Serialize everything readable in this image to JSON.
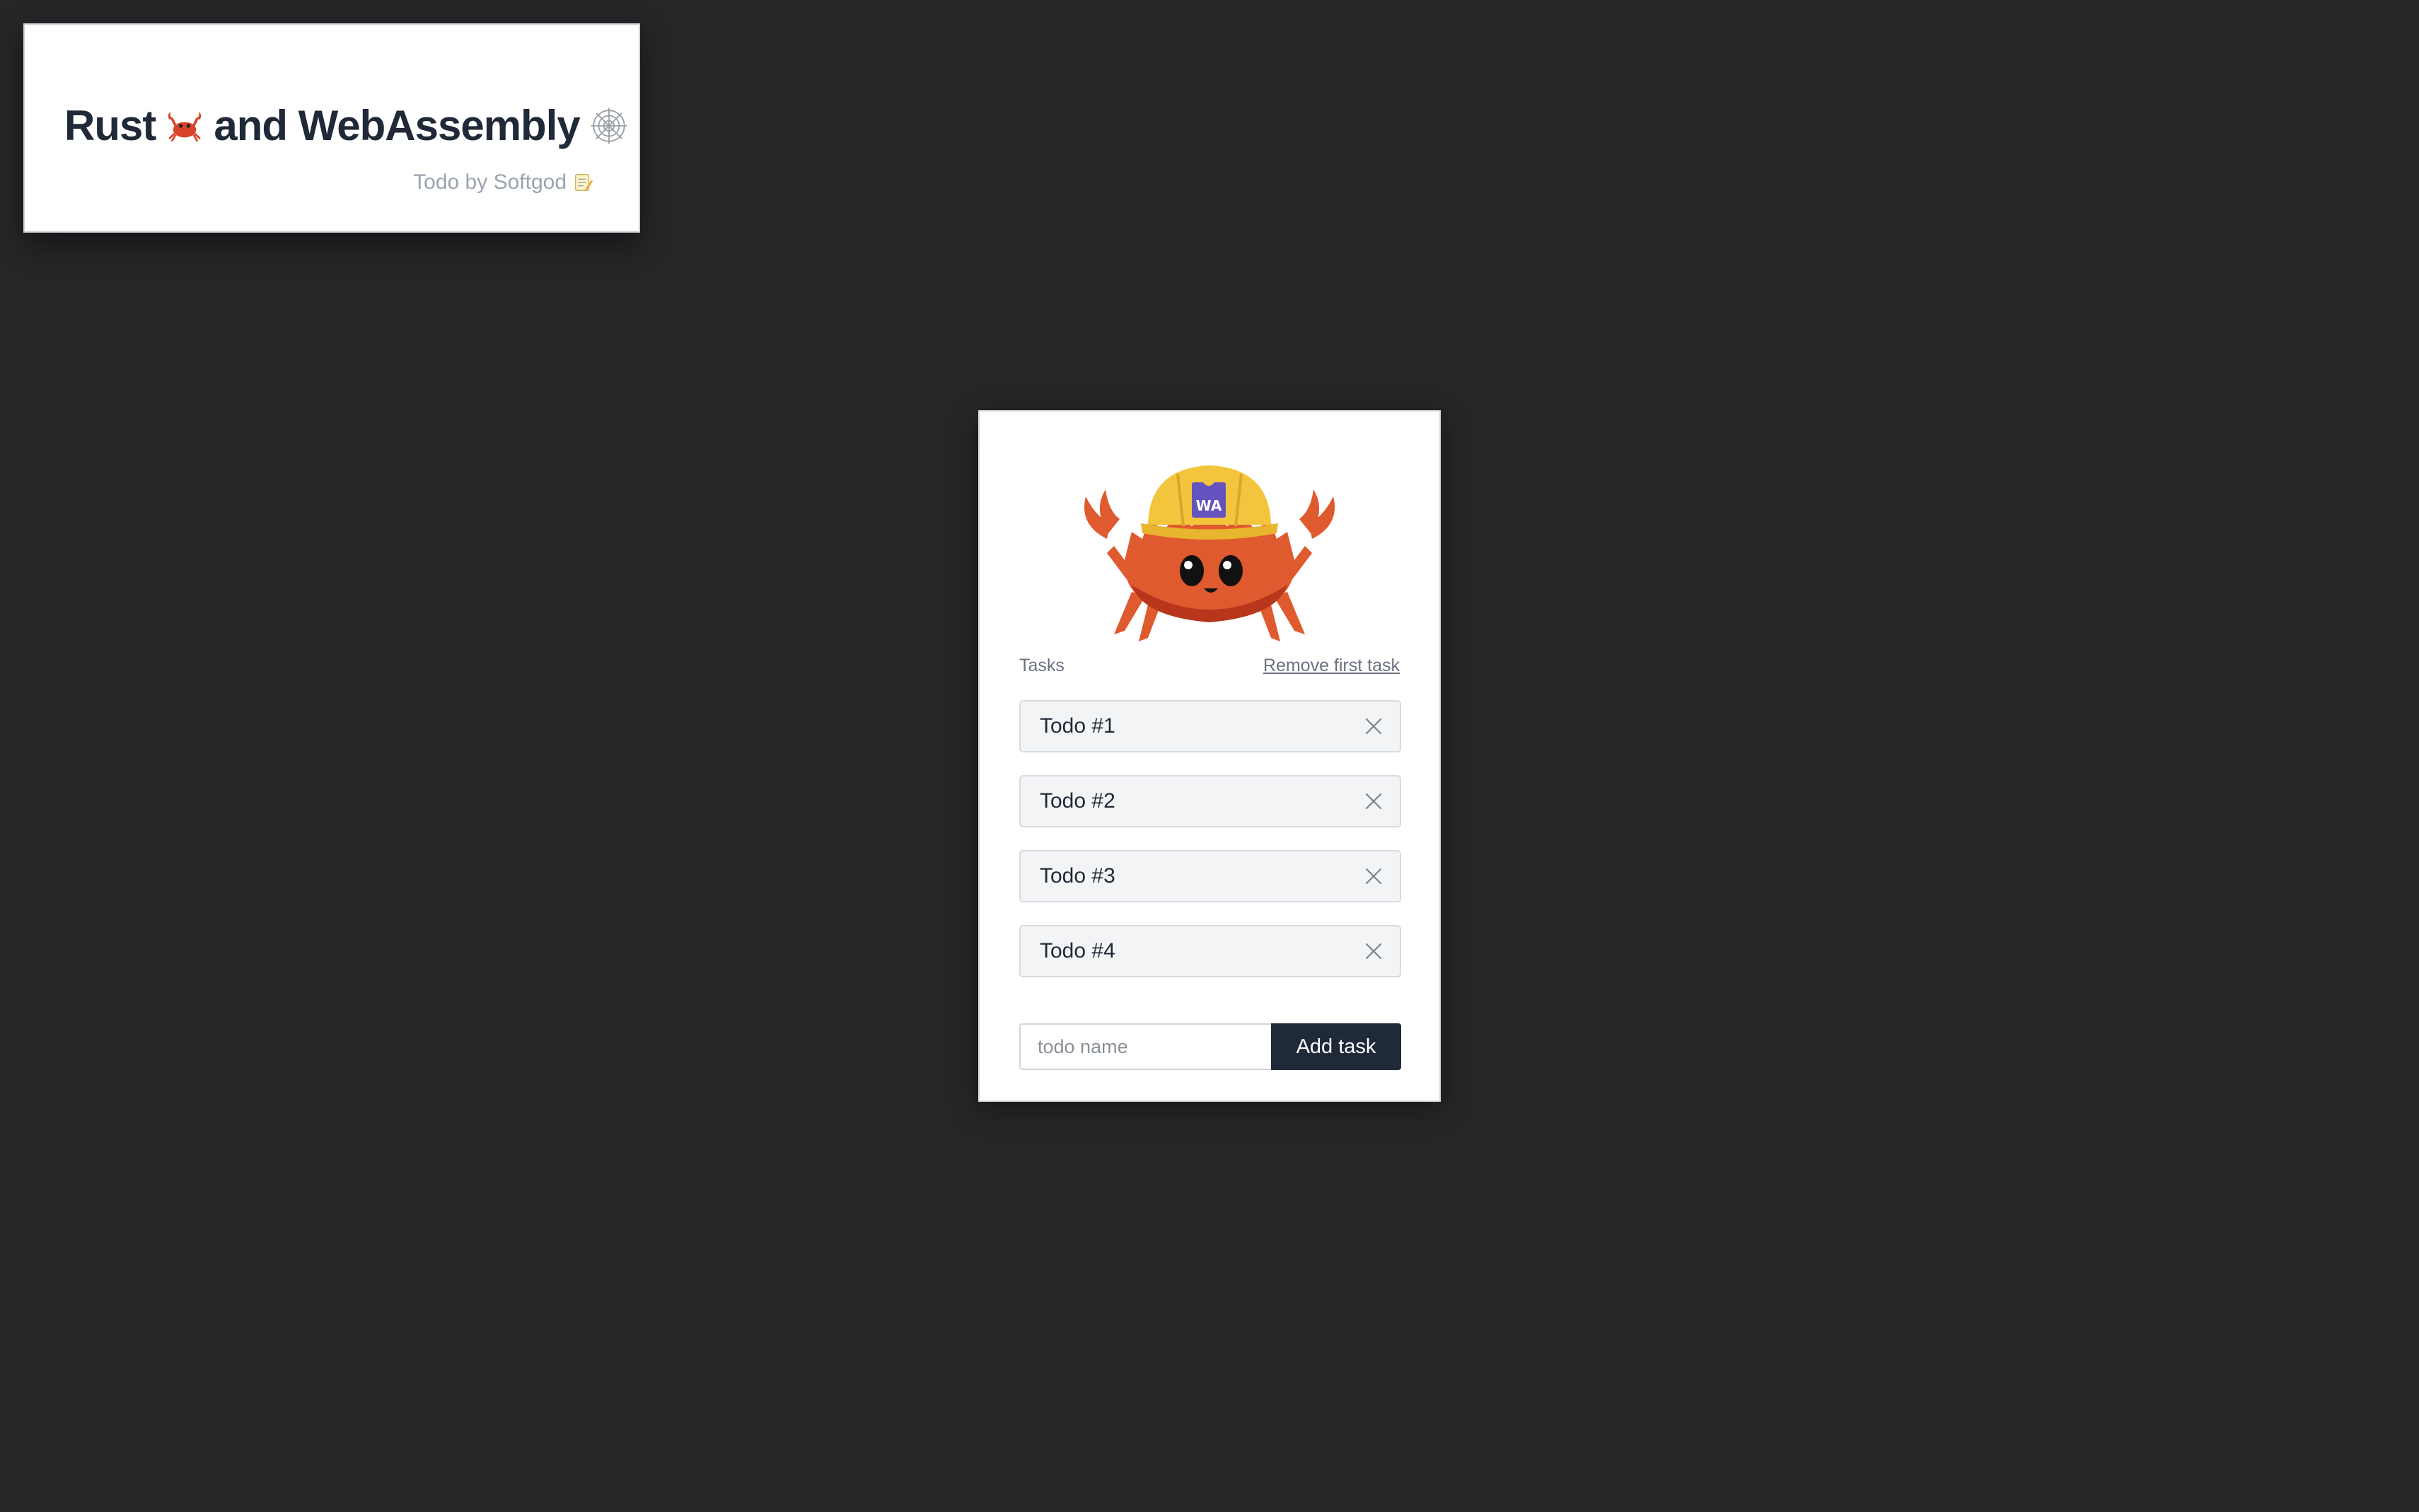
{
  "header": {
    "title_part1": "Rust",
    "title_part2": "and WebAssembly",
    "subtitle": "Todo by Softgod"
  },
  "main": {
    "mascot_badge": "WA",
    "tasks_label": "Tasks",
    "remove_first_label": "Remove first task",
    "tasks": [
      {
        "name": "Todo #1"
      },
      {
        "name": "Todo #2"
      },
      {
        "name": "Todo #3"
      },
      {
        "name": "Todo #4"
      }
    ],
    "input_placeholder": "todo name",
    "input_value": "",
    "add_button_label": "Add task"
  },
  "icons": {
    "title_emoji_1": "crab-icon",
    "title_emoji_2": "spider-web-icon",
    "subtitle_emoji": "memo-icon",
    "task_remove": "close-icon"
  },
  "colors": {
    "page_background": "#252628",
    "card_background": "#ffffff",
    "text_dark": "#1f2937",
    "text_muted": "#6b7280",
    "button_background": "#1f2937",
    "crab_orange": "#e05a2f",
    "helmet_yellow": "#f2c53d",
    "badge_purple": "#6554c0"
  }
}
